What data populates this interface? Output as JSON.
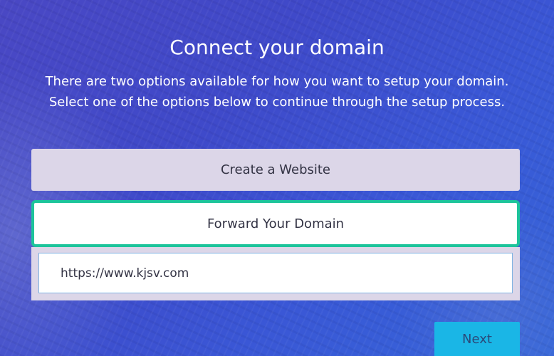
{
  "header": {
    "title": "Connect your domain",
    "description_line1": "There are two options available for how you want to setup your domain.",
    "description_line2": "Select one of the options below to continue through the setup process."
  },
  "options": {
    "create_label": "Create a Website",
    "forward_label": "Forward Your Domain",
    "selected": "Forward Your Domain"
  },
  "forward_input": {
    "value": "https://www.kjsv.com"
  },
  "actions": {
    "next_label": "Next"
  },
  "colors": {
    "background": "#4348c8",
    "selected_border": "#1dc49b",
    "option_bg": "#dcd6e8",
    "next_button": "#1ab6e6"
  }
}
